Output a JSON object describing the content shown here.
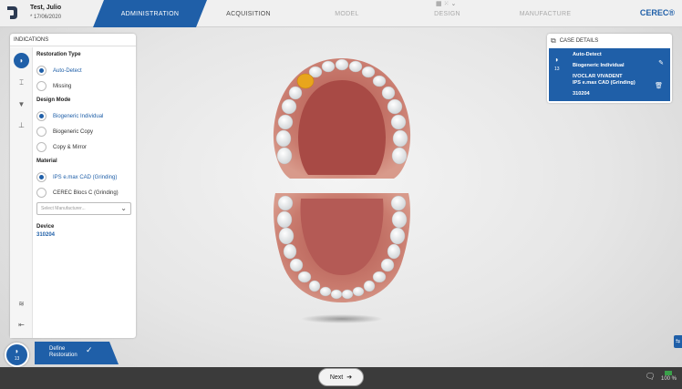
{
  "header": {
    "patient_name": "Test, Julio",
    "patient_dob": "* 17/06/2020",
    "brand": "CEREC®",
    "steps": [
      {
        "label": "ADMINISTRATION",
        "state": "active"
      },
      {
        "label": "ACQUISITION",
        "state": "normal"
      },
      {
        "label": "MODEL",
        "state": "disabled"
      },
      {
        "label": "DESIGN",
        "state": "disabled"
      },
      {
        "label": "MANUFACTURE",
        "state": "disabled"
      }
    ]
  },
  "indications": {
    "title": "INDICATIONS",
    "restoration_type": {
      "label": "Restoration Type",
      "options": [
        {
          "label": "Auto-Detect",
          "selected": true
        },
        {
          "label": "Missing",
          "selected": false
        }
      ]
    },
    "design_mode": {
      "label": "Design Mode",
      "options": [
        {
          "label": "Biogeneric Individual",
          "selected": true
        },
        {
          "label": "Biogeneric Copy",
          "selected": false
        },
        {
          "label": "Copy & Mirror",
          "selected": false
        }
      ]
    },
    "material": {
      "label": "Material",
      "options": [
        {
          "label": "IPS e.max CAD (Grinding)",
          "selected": true
        },
        {
          "label": "CEREC Blocs C (Grinding)",
          "selected": false
        }
      ],
      "manufacturer_placeholder": "Select Manufacturer..."
    },
    "device": {
      "label": "Device",
      "value": "310204"
    }
  },
  "case_details": {
    "title": "CASE DETAILS",
    "tooth_number": "13",
    "restoration_type": "Auto-Detect",
    "design_mode": "Biogeneric Individual",
    "manufacturer": "IVOCLAR VIVADENT",
    "material": "IPS e.max CAD (Grinding)",
    "device": "310204"
  },
  "bottom_tab": {
    "line1": "Define",
    "line2": "Restoration",
    "tooth_number": "13"
  },
  "footer": {
    "next_label": "Next",
    "battery": "100 %"
  },
  "colors": {
    "accent": "#1f5fa8",
    "selected_tooth": "#e8a51c",
    "gum": "#c97b6e",
    "bottom_bar": "#3b3b3b"
  }
}
